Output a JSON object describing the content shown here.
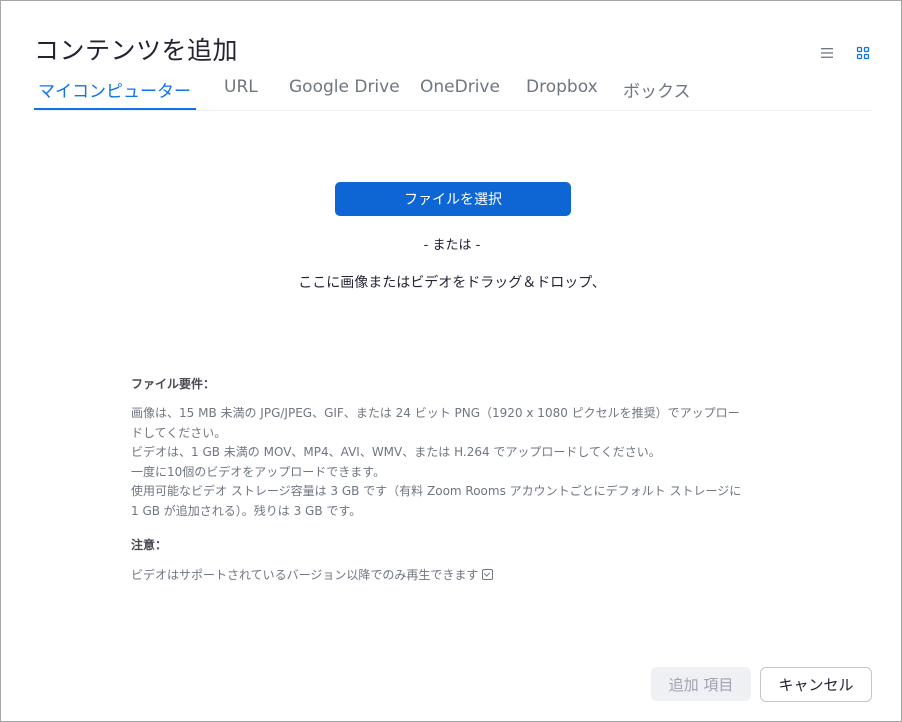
{
  "dialog": {
    "title": "コンテンツを追加"
  },
  "view_toggle": {
    "list_icon": "list-view-icon",
    "grid_icon": "grid-view-icon",
    "active": "grid",
    "accent_color": "#0e72ed"
  },
  "tabs": [
    {
      "label": "マイコンピューター",
      "active": true
    },
    {
      "label": "URL",
      "active": false
    },
    {
      "label": "Google Drive",
      "active": false
    },
    {
      "label": "OneDrive",
      "active": false
    },
    {
      "label": "Dropbox",
      "active": false
    },
    {
      "label": "ボックス",
      "active": false
    }
  ],
  "upload": {
    "choose_button": "ファイルを選択",
    "or_text": "- または -",
    "drop_text": "ここに画像またはビデオをドラッグ＆ドロップ、"
  },
  "requirements": {
    "title": "ファイル要件：",
    "lines": [
      "画像は、15 MB 未満の JPG/JPEG、GIF、または 24 ビット PNG（1920 x 1080 ピクセルを推奨）でアップロー",
      "ドしてください。",
      "ビデオは、1 GB 未満の MOV、MP4、AVI、WMV、または H.264 でアップロードしてください。",
      "一度に10個のビデオをアップロードできます。",
      "使用可能なビデオ ストレージ容量は 3 GB です（有料 Zoom Rooms アカウントごとにデフォルト ストレージに",
      "1 GB が追加される）。残りは 3 GB です。"
    ]
  },
  "note": {
    "title": "注意：",
    "text": "ビデオはサポートされているバージョン以降でのみ再生できます",
    "icon": "checkbox-icon"
  },
  "footer": {
    "add_button": "追加 項目",
    "cancel_button": "キャンセル"
  },
  "colors": {
    "primary_button": "#0e65d4",
    "tab_active": "#0e72ed",
    "disabled_button_bg": "#eff0f4"
  }
}
